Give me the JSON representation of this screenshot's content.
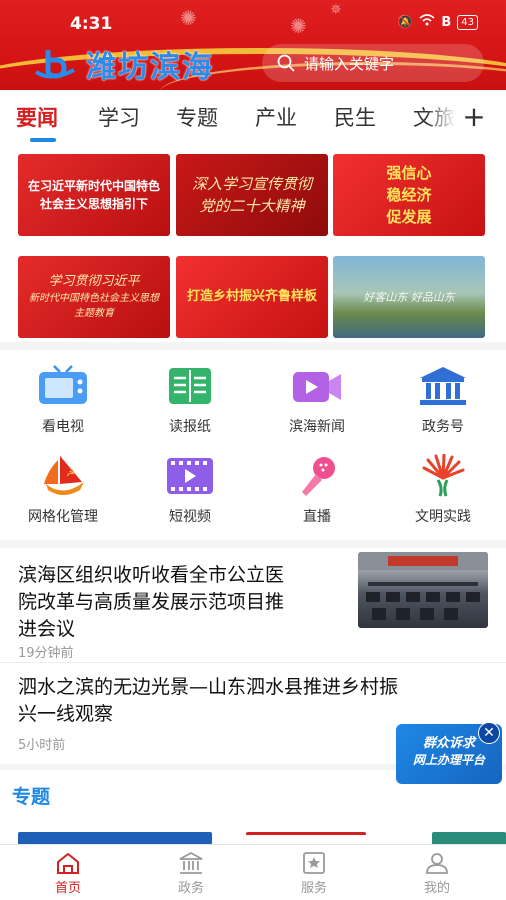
{
  "status_bar": {
    "time": "4:31",
    "battery": "43"
  },
  "header": {
    "brand": "潍坊滨海",
    "search_placeholder": "请输入关键字"
  },
  "tabs": [
    {
      "label": "要闻",
      "active": true
    },
    {
      "label": "学习",
      "active": false
    },
    {
      "label": "专题",
      "active": false
    },
    {
      "label": "产业",
      "active": false
    },
    {
      "label": "民生",
      "active": false
    },
    {
      "label": "文旅",
      "active": false
    }
  ],
  "banners": [
    {
      "line1": "在习近平新时代中国特色",
      "line2": "社会主义思想指引下"
    },
    {
      "line1": "深入学习宣传贯彻",
      "line2": "党的二十大精神"
    },
    {
      "line1": "强信心",
      "line2": "稳经济",
      "line3": "促发展"
    },
    {
      "line1": "学习贯彻习近平",
      "line2": "新时代中国特色社会主义思想",
      "line3": "主题教育"
    },
    {
      "line1": "打造乡村振兴齐鲁样板"
    },
    {
      "line1": "好客山东 好品山东"
    }
  ],
  "services": [
    {
      "label": "看电视",
      "icon": "tv-icon"
    },
    {
      "label": "读报纸",
      "icon": "newspaper-icon"
    },
    {
      "label": "滨海新闻",
      "icon": "video-camera-icon"
    },
    {
      "label": "政务号",
      "icon": "government-building-icon"
    },
    {
      "label": "网格化管理",
      "icon": "party-flag-icon"
    },
    {
      "label": "短视频",
      "icon": "film-play-icon"
    },
    {
      "label": "直播",
      "icon": "microphone-icon"
    },
    {
      "label": "文明实践",
      "icon": "civilization-emblem-icon"
    }
  ],
  "news": [
    {
      "title_line1": "滨海区组织收听收看全市公立医",
      "title_line2": "院改革与高质量发展示范项目推",
      "title_line3": "进会议",
      "time": "19分钟前"
    },
    {
      "title_line1": "泗水之滨的无边光景—山东泗水县推进乡村振",
      "title_line2": "兴一线观察",
      "time": "5小时前"
    }
  ],
  "float_badge": {
    "line1": "群众诉求",
    "line2": "网上办理平台"
  },
  "section": {
    "title": "专题"
  },
  "bottom_nav": [
    {
      "label": "首页",
      "active": true
    },
    {
      "label": "政务",
      "active": false
    },
    {
      "label": "服务",
      "active": false
    },
    {
      "label": "我的",
      "active": false
    }
  ],
  "colors": {
    "primary_red": "#d42020",
    "accent_blue": "#1e88e5"
  }
}
